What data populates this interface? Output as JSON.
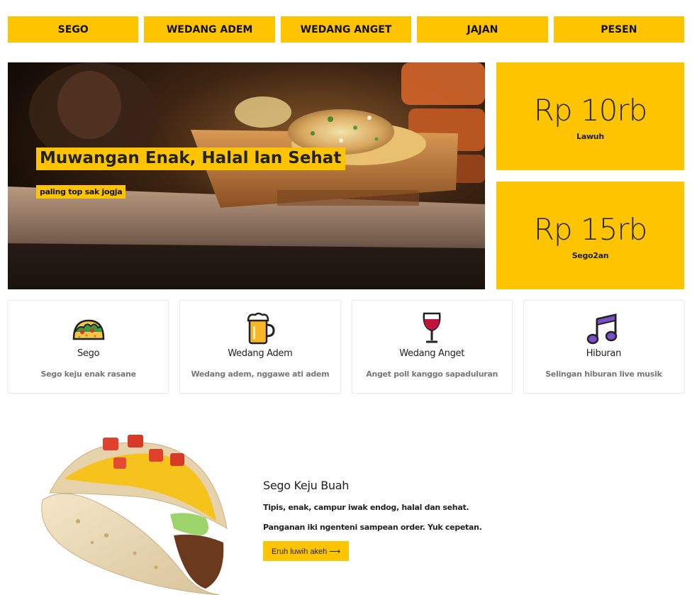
{
  "nav": {
    "items": [
      {
        "label": "SEGO"
      },
      {
        "label": "WEDANG ADEM"
      },
      {
        "label": "WEDANG ANGET"
      },
      {
        "label": "JAJAN"
      },
      {
        "label": "PESEN"
      }
    ]
  },
  "hero": {
    "title": "Muwangan Enak, Halal lan Sehat",
    "subtitle": "paling top sak jogja"
  },
  "prices": [
    {
      "amount": "Rp 10rb",
      "label": "Lawuh"
    },
    {
      "amount": "Rp 15rb",
      "label": "Sego2an"
    }
  ],
  "features": [
    {
      "icon": "taco-icon",
      "title": "Sego",
      "desc": "Sego keju enak rasane"
    },
    {
      "icon": "beer-mug-icon",
      "title": "Wedang Adem",
      "desc": "Wedang adem, nggawe ati adem"
    },
    {
      "icon": "wine-glass-icon",
      "title": "Wedang Anget",
      "desc": "Anget poll kanggo sapaduluran"
    },
    {
      "icon": "music-note-icon",
      "title": "Hiburan",
      "desc": "Selingan hiburan live musik"
    }
  ],
  "product": {
    "title": "Sego Keju Buah",
    "line1": "Tipis, enak, campur iwak endog, halal dan sehat.",
    "line2": "Panganan iki ngenteni sampean order. Yuk cepetan.",
    "button": "Eruh luwih akeh ⟶"
  },
  "colors": {
    "accent": "#ffc400",
    "text": "#222222",
    "muted": "#777777"
  }
}
